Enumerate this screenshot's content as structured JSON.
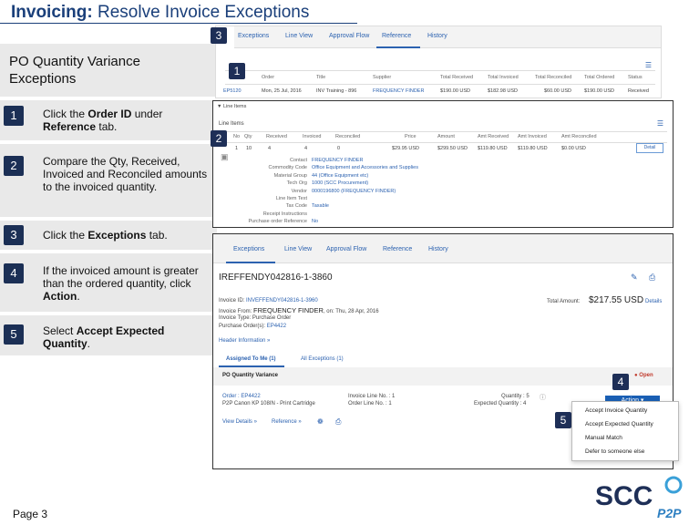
{
  "title": {
    "bold": "Invoicing:",
    "rest": " Resolve Invoice Exceptions"
  },
  "subtitle": "PO Quantity Variance Exceptions",
  "steps": [
    {
      "num": "1",
      "pre": "Click the ",
      "bold": "Order ID",
      "mid": " under ",
      "bold2": "Reference",
      "post": " tab."
    },
    {
      "num": "2",
      "text": "Compare the Qty, Received, Invoiced and Reconciled amounts to the invoiced quantity."
    },
    {
      "num": "3",
      "pre": "Click the ",
      "bold": "Exceptions",
      "post": " tab."
    },
    {
      "num": "4",
      "pre": "If the invoiced amount is greater than the ordered quantity, click ",
      "bold": "Action",
      "post": "."
    },
    {
      "num": "5",
      "pre": "Select ",
      "bold": "Accept Expected Quantity",
      "post": "."
    }
  ],
  "page_label": "Page 3",
  "badges": {
    "b1": "1",
    "b2": "2",
    "b3": "3",
    "b4": "4",
    "b5": "5"
  },
  "tabs": [
    "Exceptions",
    "Line View",
    "Approval Flow",
    "Reference",
    "History"
  ],
  "ref_table": {
    "headers": [
      "Order",
      "Title",
      "Supplier",
      "Total Received",
      "Total Invoiced",
      "Total Reconciled",
      "Total Ordered",
      "Status"
    ],
    "row": [
      "Mon, 25 Jul, 2016",
      "INV Training - 896",
      "FREQUENCY FINDER",
      "$190.00 USD",
      "$182.98 USD",
      "$60.00 USD",
      "$190.00 USD",
      "Received"
    ],
    "row_id": "EP5120"
  },
  "line_items": {
    "section": "Line Items",
    "heading": "Line Items",
    "headers": [
      "No",
      "Qty",
      "Received",
      "Invoiced",
      "Reconciled",
      "Price",
      "Amount",
      "Amt Received",
      "Amt Invoiced",
      "Amt Reconciled"
    ],
    "row": [
      "1",
      "10",
      "4",
      "4",
      "0",
      "$29.95 USD",
      "$299.50 USD",
      "$119.80 USD",
      "$119.80 USD",
      "$0.00 USD"
    ],
    "detail_button": "Detail",
    "details": [
      [
        "Contact",
        "FREQUENCY FINDER"
      ],
      [
        "Commodity Code",
        "Office Equipment and Accessories and Supplies"
      ],
      [
        "Material Group",
        "44 (Office Equipment etc)"
      ],
      [
        "Tech Org",
        "1000 (SCC Procurement)"
      ],
      [
        "Vendor",
        "0000196800 (FREQUENCY FINDER)"
      ],
      [
        "Line Item Text",
        ""
      ],
      [
        "Tax Code",
        "Taxable"
      ],
      [
        "Receipt Instructions",
        ""
      ],
      [
        "Purchase order Reference",
        "No"
      ]
    ]
  },
  "exception_view": {
    "invoice_heading": "IREFFENDY042816-1-3860",
    "invoice_id_label": "Invoice ID: ",
    "invoice_id": "INVEFFENDY042816-1-3960",
    "invoice_from_label": "Invoice From: ",
    "invoice_from": "FREQUENCY FINDER",
    "invoice_from_date": ", on: Thu, 28 Apr, 2016",
    "invoice_type": "Invoice Type: Purchase Order",
    "po_label": "Purchase Order(s): ",
    "po_value": "EP4422",
    "header_info": "Header Information »",
    "total_label": "Total Amount:",
    "total_value": "$217.55 USD",
    "details_link": "Details",
    "assigned_tab": "Assigned To Me (1)",
    "all_tab": "All Exceptions (1)",
    "variance_title": "PO Quantity Variance",
    "open_status": "Open",
    "order_line": "Order : EP4422",
    "item_line": "P2P Canon KP 108IN - Print Cartridge",
    "invoice_line_no": "Invoice Line No. : 1",
    "order_line_no": "Order Line No. : 1",
    "quantity": "Quantity : 5",
    "expected_quantity": "Expected Quantity : 4",
    "action_button": "Action ▾",
    "view_details": "View Details »",
    "reference": "Reference »",
    "dropdown": [
      "Accept Invoice Quantity",
      "Accept Expected Quantity",
      "Manual Match",
      "Defer to someone else"
    ]
  },
  "colors": {
    "title": "#1a3f7a",
    "badge": "#1e2f57",
    "link": "#2c62b0",
    "action": "#1a5fb4"
  }
}
